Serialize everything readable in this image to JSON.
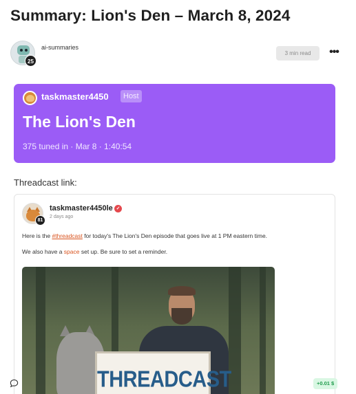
{
  "article": {
    "title": "Summary: Lion's Den – March 8, 2024",
    "author": "ai-summaries",
    "author_level": "25",
    "read_time": "3 min read"
  },
  "space": {
    "host_name": "taskmaster4450",
    "host_tag": "Host",
    "title": "The Lion's Den",
    "meta": "375 tuned in · Mar 8 · 1:40:54"
  },
  "threadcast_label": "Threadcast link:",
  "post": {
    "author": "taskmaster4450le",
    "author_level": "81",
    "time": "2 days ago",
    "line1_before": "Here is the ",
    "line1_link": "#threadcast",
    "line1_after": " for today's The Lion's Den episode that goes live at 1 PM eastern time.",
    "line2_before": "We also have a ",
    "line2_link": "space",
    "line2_after": " set up. Be sure to set a reminder.",
    "image_sign_text": "THREADCAST"
  },
  "footer": {
    "earnings": "+0.01 $"
  },
  "colors": {
    "space_card": "#9b5cf6",
    "link": "#d9531e",
    "earn_text": "#1d9a4a"
  },
  "icons": [
    "more-horizontal-icon",
    "verified-icon",
    "comment-icon"
  ]
}
